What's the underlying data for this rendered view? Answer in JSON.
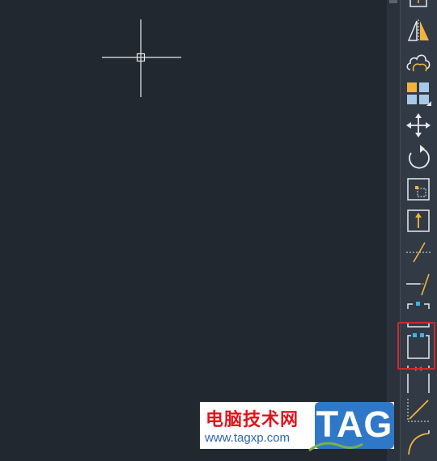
{
  "watermark": {
    "title": "电脑技术网",
    "url": "www.tagxp.com",
    "logo": "TAG"
  },
  "toolbar": {
    "tools": [
      "insert-icon",
      "mirror-icon",
      "revision-cloud-icon",
      "array-icon",
      "move-icon",
      "rotate-icon",
      "scale-icon",
      "stretch-icon",
      "trim-icon",
      "extend-icon",
      "break-at-point-icon",
      "break-icon",
      "join-icon",
      "chamfer-icon",
      "fillet-icon"
    ]
  },
  "colors": {
    "canvas": "#212830",
    "toolbar": "#323a45",
    "icon": "#e6e9ee",
    "accent_yellow": "#f0b43c",
    "accent_blue": "#3db2ea",
    "highlight": "#d0282b"
  }
}
